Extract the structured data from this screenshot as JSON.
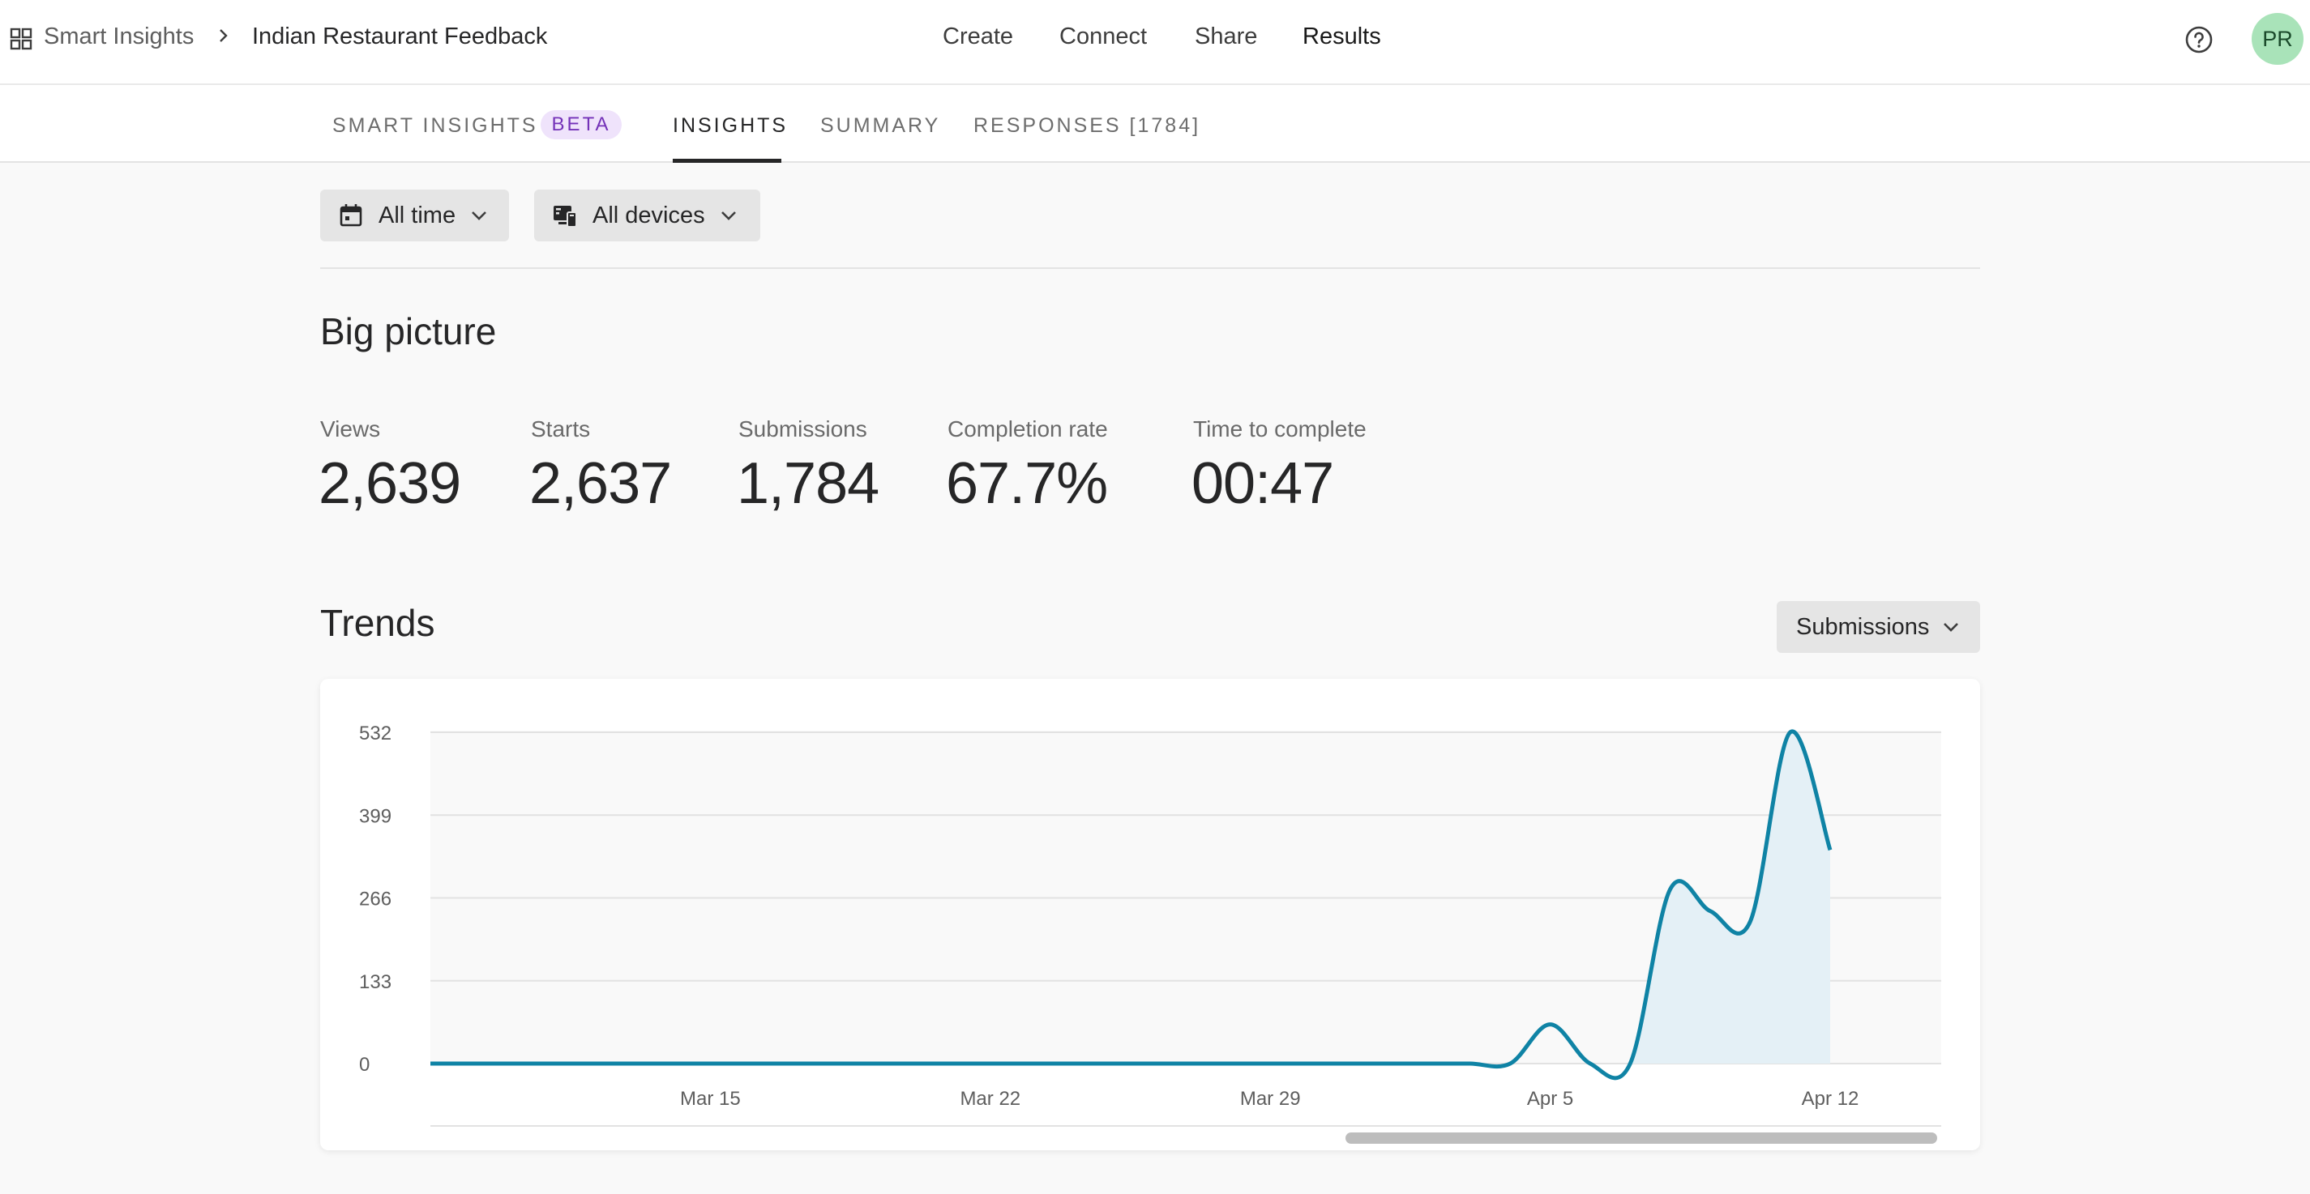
{
  "header": {
    "breadcrumb_root": "Smart Insights",
    "breadcrumb_current": "Indian Restaurant Feedback",
    "nav": [
      "Create",
      "Connect",
      "Share",
      "Results"
    ],
    "active_nav": "Results",
    "avatar_initials": "PR",
    "avatar_color": "#a9e3b9"
  },
  "subnav": {
    "smart_insights": "SMART INSIGHTS",
    "beta_badge": "BETA",
    "insights": "INSIGHTS",
    "summary": "SUMMARY",
    "responses": "RESPONSES [1784]",
    "active_tab": "INSIGHTS"
  },
  "filters": {
    "date": "All time",
    "device": "All devices"
  },
  "big_picture": {
    "title": "Big picture",
    "metrics": [
      {
        "label": "Views",
        "value": "2,639"
      },
      {
        "label": "Starts",
        "value": "2,637"
      },
      {
        "label": "Submissions",
        "value": "1,784"
      },
      {
        "label": "Completion rate",
        "value": "67.7%"
      },
      {
        "label": "Time to complete",
        "value": "00:47"
      }
    ]
  },
  "trends": {
    "title": "Trends",
    "metric_selector": "Submissions"
  },
  "chart_data": {
    "type": "area",
    "series": [
      {
        "values": [
          {
            "x": "Mar 8",
            "y": 0
          },
          {
            "x": "Mar 9",
            "y": 0
          },
          {
            "x": "Mar 10",
            "y": 0
          },
          {
            "x": "Mar 11",
            "y": 0
          },
          {
            "x": "Mar 12",
            "y": 0
          },
          {
            "x": "Mar 13",
            "y": 0
          },
          {
            "x": "Mar 14",
            "y": 0
          },
          {
            "x": "Mar 15",
            "y": 0
          },
          {
            "x": "Mar 16",
            "y": 0
          },
          {
            "x": "Mar 17",
            "y": 0
          },
          {
            "x": "Mar 18",
            "y": 0
          },
          {
            "x": "Mar 19",
            "y": 0
          },
          {
            "x": "Mar 20",
            "y": 0
          },
          {
            "x": "Mar 21",
            "y": 0
          },
          {
            "x": "Mar 22",
            "y": 0
          },
          {
            "x": "Mar 23",
            "y": 0
          },
          {
            "x": "Mar 24",
            "y": 0
          },
          {
            "x": "Mar 25",
            "y": 0
          },
          {
            "x": "Mar 26",
            "y": 0
          },
          {
            "x": "Mar 27",
            "y": 0
          },
          {
            "x": "Mar 28",
            "y": 0
          },
          {
            "x": "Mar 29",
            "y": 0
          },
          {
            "x": "Mar 30",
            "y": 0
          },
          {
            "x": "Mar 31",
            "y": 0
          },
          {
            "x": "Apr 1",
            "y": 0
          },
          {
            "x": "Apr 2",
            "y": 0
          },
          {
            "x": "Apr 3",
            "y": 0
          },
          {
            "x": "Apr 4",
            "y": 0
          },
          {
            "x": "Apr 5",
            "y": 63
          },
          {
            "x": "Apr 6",
            "y": 0
          },
          {
            "x": "Apr 7",
            "y": 0
          },
          {
            "x": "Apr 8",
            "y": 280
          },
          {
            "x": "Apr 9",
            "y": 245
          },
          {
            "x": "Apr 10",
            "y": 228
          },
          {
            "x": "Apr 11",
            "y": 532
          },
          {
            "x": "Apr 12",
            "y": 343
          }
        ]
      }
    ],
    "x_ticks": [
      "Mar 15",
      "Mar 22",
      "Mar 29",
      "Apr 5",
      "Apr 12"
    ],
    "y_ticks": [
      0,
      133,
      266,
      399,
      532
    ],
    "ylim": [
      0,
      532
    ],
    "grid": true,
    "colors": {
      "line": "#0f83a5",
      "fill": "#e4f0f6"
    }
  }
}
